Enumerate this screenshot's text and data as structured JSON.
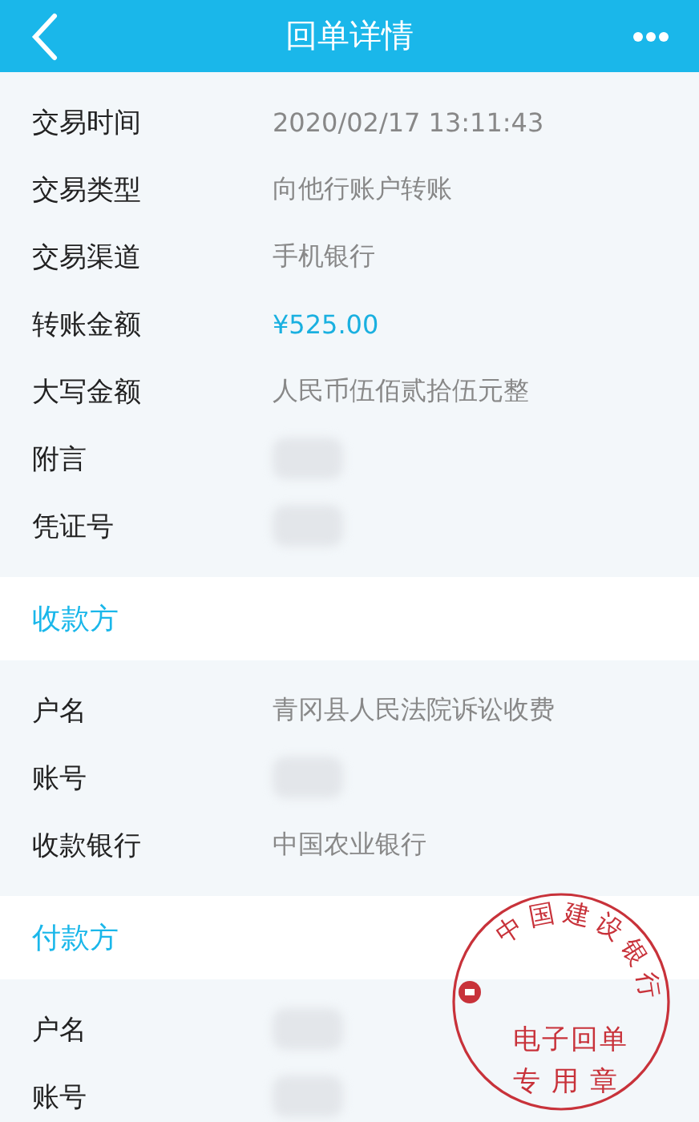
{
  "header": {
    "title": "回单详情"
  },
  "details": [
    {
      "label": "交易时间",
      "kind": "text",
      "value": "2020/02/17  13:11:43"
    },
    {
      "label": "交易类型",
      "kind": "text",
      "value": "向他行账户转账"
    },
    {
      "label": "交易渠道",
      "kind": "text",
      "value": "手机银行"
    },
    {
      "label": "转账金额",
      "kind": "amount",
      "value": "¥525.00"
    },
    {
      "label": "大写金额",
      "kind": "text",
      "value": "人民币伍佰贰拾伍元整"
    },
    {
      "label": "附言",
      "kind": "redacted"
    },
    {
      "label": "凭证号",
      "kind": "redacted"
    }
  ],
  "sections": [
    {
      "title": "收款方",
      "rows": [
        {
          "label": "户名",
          "kind": "text",
          "value": "青冈县人民法院诉讼收费"
        },
        {
          "label": "账号",
          "kind": "redacted"
        },
        {
          "label": "收款银行",
          "kind": "text",
          "value": "中国农业银行"
        }
      ]
    },
    {
      "title": "付款方",
      "rows": [
        {
          "label": "户名",
          "kind": "redacted"
        },
        {
          "label": "账号",
          "kind": "redacted"
        }
      ]
    }
  ],
  "stamp": {
    "bank": "中国建设银行",
    "lines": [
      "电子回单",
      "专用章"
    ]
  }
}
